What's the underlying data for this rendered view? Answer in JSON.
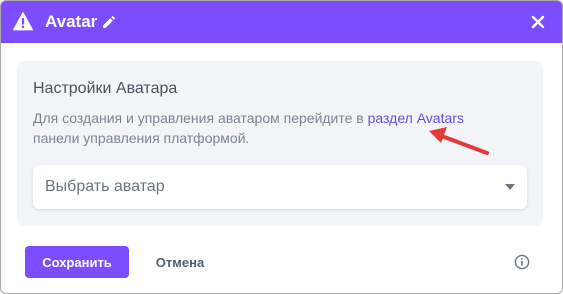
{
  "dialog": {
    "title": "Avatar",
    "header_color": "#7c4dff",
    "icons": [
      "warning-icon",
      "edit-icon",
      "close-icon"
    ]
  },
  "settings": {
    "title": "Настройки Аватара",
    "description_prefix": "Для создания и управления аватаром перейдите в ",
    "link_text": "раздел Avatars",
    "description_suffix": " панели управления платформой.",
    "select_placeholder": "Выбрать аватар"
  },
  "footer": {
    "save_label": "Сохранить",
    "cancel_label": "Отмена",
    "info_icon": "info-icon"
  }
}
